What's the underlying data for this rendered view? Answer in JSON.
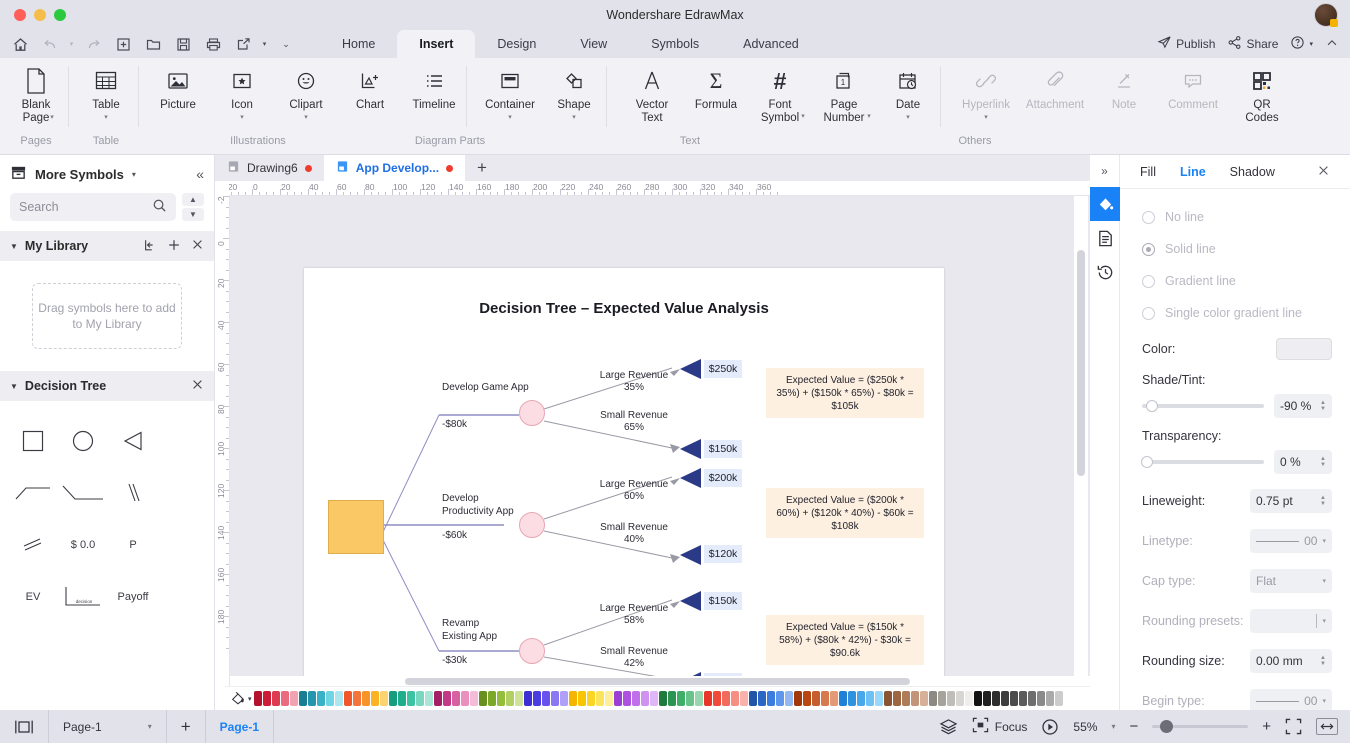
{
  "window": {
    "title": "Wondershare EdrawMax",
    "traffic_lights": [
      "close",
      "minimize",
      "maximize"
    ]
  },
  "quick_access": {
    "icons": [
      "home-icon",
      "undo-icon",
      "redo-icon",
      "new-icon",
      "open-icon",
      "save-icon",
      "print-icon",
      "export-icon",
      "more-icon"
    ],
    "right_items": [
      {
        "label": "Publish",
        "icon": "publish-icon"
      },
      {
        "label": "Share",
        "icon": "share-icon"
      }
    ],
    "help_icon": "help-icon",
    "collapse_icon": "chevron-up-icon"
  },
  "ribbon": {
    "tabs": [
      {
        "label": "Home",
        "active": false
      },
      {
        "label": "Insert",
        "active": true
      },
      {
        "label": "Design",
        "active": false
      },
      {
        "label": "View",
        "active": false
      },
      {
        "label": "Symbols",
        "active": false
      },
      {
        "label": "Advanced",
        "active": false
      }
    ],
    "groups": [
      {
        "name": "Pages",
        "items": [
          {
            "label": "Blank\nPage",
            "icon": "blank-page-icon",
            "caret": true,
            "disabled": false
          }
        ]
      },
      {
        "name": "Table",
        "items": [
          {
            "label": "Table",
            "icon": "table-icon",
            "caret": true,
            "disabled": false
          }
        ]
      },
      {
        "name": "Illustrations",
        "items": [
          {
            "label": "Picture",
            "icon": "picture-icon",
            "caret": false,
            "disabled": false
          },
          {
            "label": "Icon",
            "icon": "icon-icon",
            "caret": true,
            "disabled": false
          },
          {
            "label": "Clipart",
            "icon": "clipart-icon",
            "caret": true,
            "disabled": false
          },
          {
            "label": "Chart",
            "icon": "chart-icon",
            "caret": false,
            "disabled": false
          },
          {
            "label": "Timeline",
            "icon": "timeline-icon",
            "caret": false,
            "disabled": false
          }
        ]
      },
      {
        "name": "Diagram Parts",
        "items": [
          {
            "label": "Container",
            "icon": "container-icon",
            "caret": true,
            "disabled": false
          },
          {
            "label": "Shape",
            "icon": "shape-icon",
            "caret": true,
            "disabled": false
          }
        ]
      },
      {
        "name": "Text",
        "items": [
          {
            "label": "Vector\nText",
            "icon": "vector-text-icon",
            "caret": false,
            "disabled": false
          },
          {
            "label": "Formula",
            "icon": "formula-icon",
            "caret": false,
            "disabled": false
          },
          {
            "label": "Font\nSymbol",
            "icon": "font-symbol-icon",
            "caret": true,
            "disabled": false
          },
          {
            "label": "Page\nNumber",
            "icon": "page-number-icon",
            "caret": true,
            "disabled": false
          },
          {
            "label": "Date",
            "icon": "date-icon",
            "caret": true,
            "disabled": false
          }
        ]
      },
      {
        "name": "Others",
        "items": [
          {
            "label": "Hyperlink",
            "icon": "hyperlink-icon",
            "caret": true,
            "disabled": true
          },
          {
            "label": "Attachment",
            "icon": "attachment-icon",
            "caret": false,
            "disabled": true
          },
          {
            "label": "Note",
            "icon": "note-icon",
            "caret": false,
            "disabled": true
          },
          {
            "label": "Comment",
            "icon": "comment-icon",
            "caret": false,
            "disabled": true
          },
          {
            "label": "QR\nCodes",
            "icon": "qr-codes-icon",
            "caret": false,
            "disabled": false
          }
        ]
      }
    ]
  },
  "left_panel": {
    "title": "More Symbols",
    "collapse_icon": "chevron-double-left-icon",
    "search": {
      "placeholder": "Search",
      "icon": "search-icon"
    },
    "library": {
      "title": "My Library",
      "actions": [
        "import-icon",
        "add-icon",
        "close-icon"
      ],
      "dropzone_text": "Drag symbols here to add to My Library"
    },
    "category": {
      "title": "Decision Tree",
      "close_icon": "close-icon",
      "symbols": [
        {
          "name": "square-symbol",
          "label": ""
        },
        {
          "name": "circle-symbol",
          "label": ""
        },
        {
          "name": "triangle-symbol",
          "label": ""
        },
        {
          "name": "elbow-up-symbol",
          "label": ""
        },
        {
          "name": "elbow-down-symbol",
          "label": ""
        },
        {
          "name": "double-slash-symbol",
          "label": ""
        },
        {
          "name": "double-slash-alt-symbol",
          "label": ""
        },
        {
          "name": "cost-symbol",
          "label": "$ 0.0"
        },
        {
          "name": "probability-symbol",
          "label": "P"
        },
        {
          "name": "ev-symbol",
          "label": "EV"
        },
        {
          "name": "decision-label-symbol",
          "label": "decision"
        },
        {
          "name": "payoff-symbol",
          "label": "Payoff"
        }
      ]
    }
  },
  "doc_tabs": {
    "tabs": [
      {
        "label": "Drawing6",
        "active": false,
        "modified": true
      },
      {
        "label": "App Develop...",
        "active": true,
        "modified": true
      }
    ],
    "add_label": "+"
  },
  "rulers": {
    "horizontal": [
      "-20",
      "0",
      "20",
      "40",
      "60",
      "80",
      "100",
      "120",
      "140",
      "160",
      "180",
      "200",
      "220",
      "240",
      "260",
      "280",
      "300",
      "320",
      "340",
      "360"
    ],
    "vertical": [
      "-20",
      "0",
      "20",
      "40",
      "60",
      "80",
      "100",
      "120",
      "140",
      "160",
      "180"
    ]
  },
  "chart_data": {
    "type": "diagram",
    "title": "Decision Tree – Expected Value Analysis",
    "root": {
      "name": "decision-node",
      "shape": "square",
      "color": "#fbc866"
    },
    "branches": [
      {
        "decision": "Develop Game App",
        "cost": "-$80k",
        "chance_node": "chance-node",
        "outcomes": [
          {
            "label": "Large Revenue",
            "probability": "35%",
            "payoff": "$250k"
          },
          {
            "label": "Small Revenue",
            "probability": "65%",
            "payoff": "$150k"
          }
        ],
        "expected_value": "Expected Value = ($250k * 35%) + ($150k * 65%) - $80k = $105k"
      },
      {
        "decision": "Develop Productivity App",
        "cost": "-$60k",
        "chance_node": "chance-node",
        "outcomes": [
          {
            "label": "Large Revenue",
            "probability": "60%",
            "payoff": "$200k"
          },
          {
            "label": "Small Revenue",
            "probability": "40%",
            "payoff": "$120k"
          }
        ],
        "expected_value": "Expected Value = ($200k * 60%) + ($120k * 40%) - $60k = $108k"
      },
      {
        "decision": "Revamp Existing App",
        "cost": "-$30k",
        "chance_node": "chance-node",
        "outcomes": [
          {
            "label": "Large Revenue",
            "probability": "58%",
            "payoff": "$150k"
          },
          {
            "label": "Small Revenue",
            "probability": "42%",
            "payoff": ""
          }
        ],
        "expected_value": "Expected Value = ($150k * 58%) + ($80k * 42%) - $30k = $90.6k"
      }
    ],
    "colors": {
      "decision_node": "#fbc866",
      "chance_node": "#fbdde3",
      "payoff_node": "#2a3a86",
      "payoff_box": "#e4ebfb",
      "ev_box": "#fdf0e0"
    }
  },
  "palette": {
    "tool_icon": "fill-bucket-icon",
    "swatches": [
      "#b4112c",
      "#cc1c36",
      "#de3a52",
      "#ea6a80",
      "#f2a3b2",
      "#197d93",
      "#2395ad",
      "#39b2c8",
      "#6fd4e4",
      "#aee6ef",
      "#f0572b",
      "#f4743e",
      "#f79328",
      "#fbb324",
      "#fcd371",
      "#169c7e",
      "#1fae8c",
      "#3cc3a3",
      "#79d7bf",
      "#abe5d6",
      "#a51f66",
      "#c23a86",
      "#d95fa3",
      "#ea8fbe",
      "#f4bcd6",
      "#67901e",
      "#7ca827",
      "#93bd3a",
      "#b1cf63",
      "#cfe398",
      "#3c2fd4",
      "#4a3ee0",
      "#6a52ef",
      "#8b77f3",
      "#aea1f7",
      "#f5b400",
      "#f9c400",
      "#fbd525",
      "#fce35c",
      "#fdee9a",
      "#9b3fd4",
      "#ae53e0",
      "#c070ea",
      "#d092f1",
      "#dfb6f6",
      "#1f7a3d",
      "#2a9450",
      "#3fae66",
      "#69c389",
      "#97d7ae",
      "#e8372a",
      "#ef4a3a",
      "#f26a5c",
      "#f68e84",
      "#f9b2ab",
      "#2254a8",
      "#2a66c4",
      "#3a7ce0",
      "#5f97ec",
      "#94b9f2",
      "#a0380a",
      "#b8480f",
      "#c75d2c",
      "#d67a4e",
      "#e49a77",
      "#1e81d4",
      "#2f92e0",
      "#49a8ec",
      "#6dc1f5",
      "#98d8fb",
      "#8a5432",
      "#9c6641",
      "#ae7c59",
      "#c2957a",
      "#d6b098",
      "#8d8a84",
      "#a6a39d",
      "#bfbdb7",
      "#d8d6d2",
      "#efeeeb",
      "#121212",
      "#1f1f1f",
      "#2e2e2e",
      "#3d3d3d",
      "#4c4c4c",
      "#5c5c5c",
      "#6e6e6e",
      "#8a8a8a",
      "#aaaaaa",
      "#cccccc"
    ]
  },
  "right_panel": {
    "expand_icon": "chevron-double-right-icon",
    "strip_icons": [
      "fill-icon",
      "properties-icon",
      "history-icon"
    ],
    "tabs": [
      {
        "label": "Fill",
        "active": false
      },
      {
        "label": "Line",
        "active": true
      },
      {
        "label": "Shadow",
        "active": false
      }
    ],
    "close_icon": "close-icon",
    "line_options": [
      {
        "label": "No line",
        "selected": false
      },
      {
        "label": "Solid line",
        "selected": true
      },
      {
        "label": "Gradient line",
        "selected": false
      },
      {
        "label": "Single color gradient line",
        "selected": false
      }
    ],
    "properties": {
      "color_label": "Color:",
      "shade_label": "Shade/Tint:",
      "shade_value": "-90 %",
      "transparency_label": "Transparency:",
      "transparency_value": "0 %",
      "lineweight_label": "Lineweight:",
      "lineweight_value": "0.75 pt",
      "linetype_label": "Linetype:",
      "linetype_value": "00",
      "captype_label": "Cap type:",
      "captype_value": "Flat",
      "rounding_presets_label": "Rounding presets:",
      "rounding_presets_value": "",
      "rounding_size_label": "Rounding size:",
      "rounding_size_value": "0.00 mm",
      "begin_type_label": "Begin type:",
      "begin_type_value": "00"
    }
  },
  "status_bar": {
    "layout_icon": "page-layout-icon",
    "page_select": "Page-1",
    "add_page_icon": "add-icon",
    "current_page_tab": "Page-1",
    "layers_icon": "layers-icon",
    "focus_label": "Focus",
    "focus_icon": "focus-icon",
    "present_icon": "present-icon",
    "zoom_level": "55%",
    "zoom_out_icon": "minus-icon",
    "zoom_in_icon": "plus-icon",
    "fit_icon": "fit-page-icon",
    "fit_width_icon": "fit-width-icon"
  }
}
